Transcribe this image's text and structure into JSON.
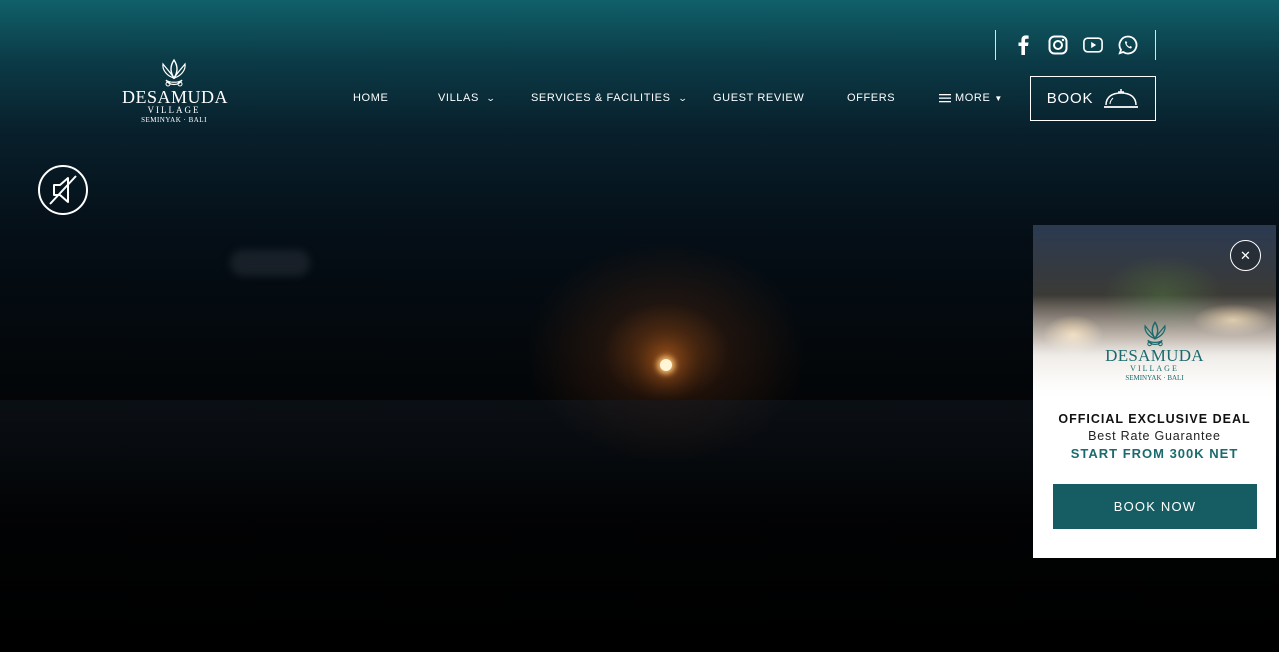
{
  "logo": {
    "brand": "DESAMUDA",
    "line2": "VILLAGE",
    "line3": "SEMINYAK · BALI"
  },
  "social": {
    "icons": [
      "facebook-icon",
      "instagram-icon",
      "youtube-icon",
      "whatsapp-icon"
    ]
  },
  "nav": {
    "home": "HOME",
    "villas": "VILLAS",
    "services": "SERVICES & FACILITIES",
    "guest_review": "GUEST REVIEW",
    "offers": "OFFERS",
    "more": "MORE"
  },
  "book_button": {
    "label": "BOOK",
    "icon": "service-bell-icon"
  },
  "mute_button": {
    "icon": "speaker-muted-icon"
  },
  "promo": {
    "close_icon": "close-icon",
    "logo_brand": "DESAMUDA",
    "logo_line2": "VILLAGE",
    "logo_line3": "SEMINYAK · BALI",
    "headline": "OFFICIAL EXCLUSIVE DEAL",
    "subline": "Best Rate Guarantee",
    "price_line": "START FROM 300K NET",
    "button_label": "BOOK NOW"
  },
  "colors": {
    "accent_teal": "#155d63",
    "brand_teal_text": "#1a6a6e",
    "header_teal": "#10606a"
  }
}
